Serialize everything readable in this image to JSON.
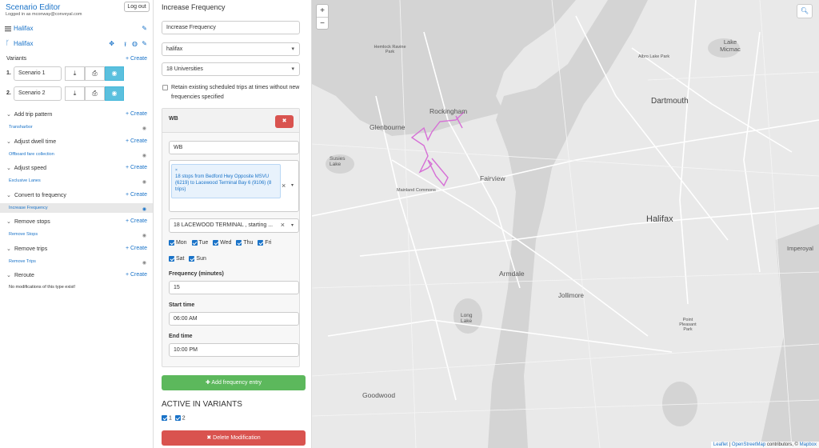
{
  "app": {
    "title": "Scenario Editor",
    "logged_in": "Logged in as mconway@conveyal.com",
    "logout": "Log out"
  },
  "project": {
    "name": "Halifax",
    "bundle": "Halifax"
  },
  "variants": {
    "label": "Variants",
    "create": "Create",
    "items": [
      {
        "num": "1.",
        "name": "Scenario 1"
      },
      {
        "num": "2.",
        "name": "Scenario 2"
      }
    ]
  },
  "categories": [
    {
      "label": "Add trip pattern",
      "create": "Create",
      "items": [
        "Transharbor"
      ]
    },
    {
      "label": "Adjust dwell time",
      "create": "Create",
      "items": [
        "Offboard fare collection"
      ]
    },
    {
      "label": "Adjust speed",
      "create": "Create",
      "items": [
        "Exclusive Lanes"
      ]
    },
    {
      "label": "Convert to frequency",
      "create": "Create",
      "items": [
        "Increase Frequency"
      ]
    },
    {
      "label": "Remove stops",
      "create": "Create",
      "items": [
        "Remove Stops"
      ]
    },
    {
      "label": "Remove trips",
      "create": "Create",
      "items": [
        "Remove Trips"
      ]
    },
    {
      "label": "Reroute",
      "create": "Create",
      "items": []
    }
  ],
  "reroute_empty": "No modifications of this type exist!",
  "editor": {
    "title": "Increase Frequency",
    "name_value": "Increase Frequency",
    "feed": "halifax",
    "route": "18 Universities",
    "retain_label": "Retain existing scheduled trips at times without new frequencies specified",
    "entry": {
      "title": "WB",
      "name_value": "WB",
      "segment_tag": "18 stops from Bedford Hwy Opposite MSVU (6219) to Lacewood Terminal Bay 6 (9106) (8 trips)",
      "trip": "18 LACEWOOD TERMINAL , starting ...",
      "days": [
        {
          "d": "Mon",
          "on": true
        },
        {
          "d": "Tue",
          "on": true
        },
        {
          "d": "Wed",
          "on": true
        },
        {
          "d": "Thu",
          "on": true
        },
        {
          "d": "Fri",
          "on": true
        },
        {
          "d": "Sat",
          "on": true
        },
        {
          "d": "Sun",
          "on": true
        }
      ],
      "freq_label": "Frequency (minutes)",
      "freq": "15",
      "start_label": "Start time",
      "start": "06:00  AM",
      "end_label": "End time",
      "end": "10:00  PM"
    },
    "add_entry": "Add frequency entry",
    "active_title": "ACTIVE IN VARIANTS",
    "active": [
      {
        "n": "1",
        "on": true
      },
      {
        "n": "2",
        "on": true
      }
    ],
    "delete": "Delete Modification"
  },
  "map": {
    "attribution_leaflet": "Leaflet",
    "attribution_osm": "OpenStreetMap",
    "attribution_contrib": " contributors, © ",
    "attribution_mapbox": "Mapbox",
    "labels": {
      "rockingham": "Rockingham",
      "glenbourne": "Glenbourne",
      "fairview": "Fairview",
      "halifax": "Halifax",
      "dartmouth": "Dartmouth",
      "armdale": "Armdale",
      "jollimore": "Jollimore",
      "goodwood": "Goodwood",
      "sussie": "Susies Lake",
      "long": "Long Lake",
      "mainland": "Mainland Commons",
      "hemlock": "Hemlock Ravine Park",
      "albro": "Albro Lake Park",
      "micmac": "Lake Micmac",
      "imperoyal": "Imperoyal",
      "pleasant": "Point Pleasant Park"
    }
  },
  "colors": {
    "route": "#d670d6",
    "accent": "#1a73c8",
    "water": "#d4d4d4",
    "land": "#e9e9e9"
  }
}
